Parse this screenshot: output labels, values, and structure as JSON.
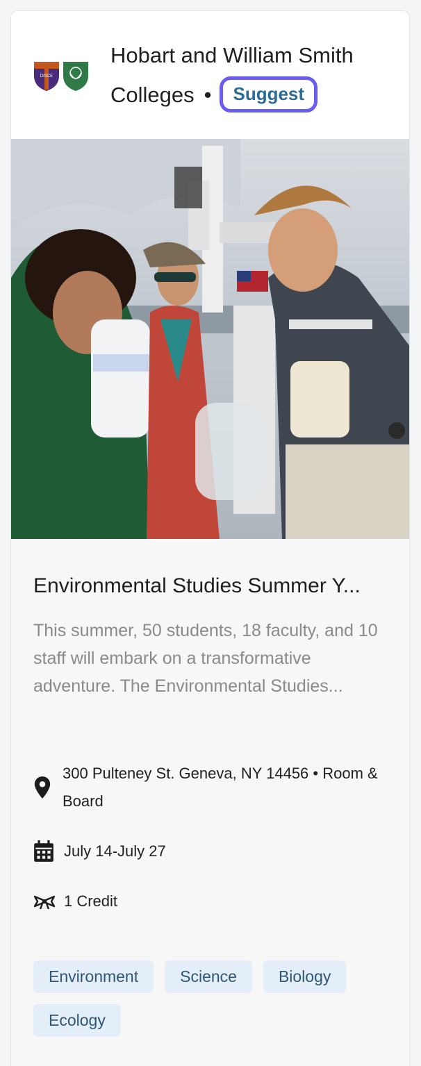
{
  "header": {
    "organization": "Hobart and William Smith Colleges",
    "separator": "•",
    "suggest_label": "Suggest",
    "logo_text": "DISCE"
  },
  "program": {
    "title": "Environmental Studies Summer Y...",
    "description": "This summer, 50 students, 18 faculty, and 10 staff will embark on a transformative adventure. The Environmental Studies...",
    "location": "300 Pulteney St. Geneva, NY 14456 • Room & Board",
    "dates": "July 14-July 27",
    "credit": "1 Credit"
  },
  "tags": [
    "Environment",
    "Science",
    "Biology",
    "Ecology"
  ],
  "icons": {
    "location": "map-pin-icon",
    "dates": "calendar-icon",
    "credit": "ribbon-icon"
  },
  "colors": {
    "suggest_border": "#6a5cf0",
    "suggest_text": "#2d6b94",
    "tag_bg": "#e4eef8",
    "tag_text": "#2e5776"
  }
}
